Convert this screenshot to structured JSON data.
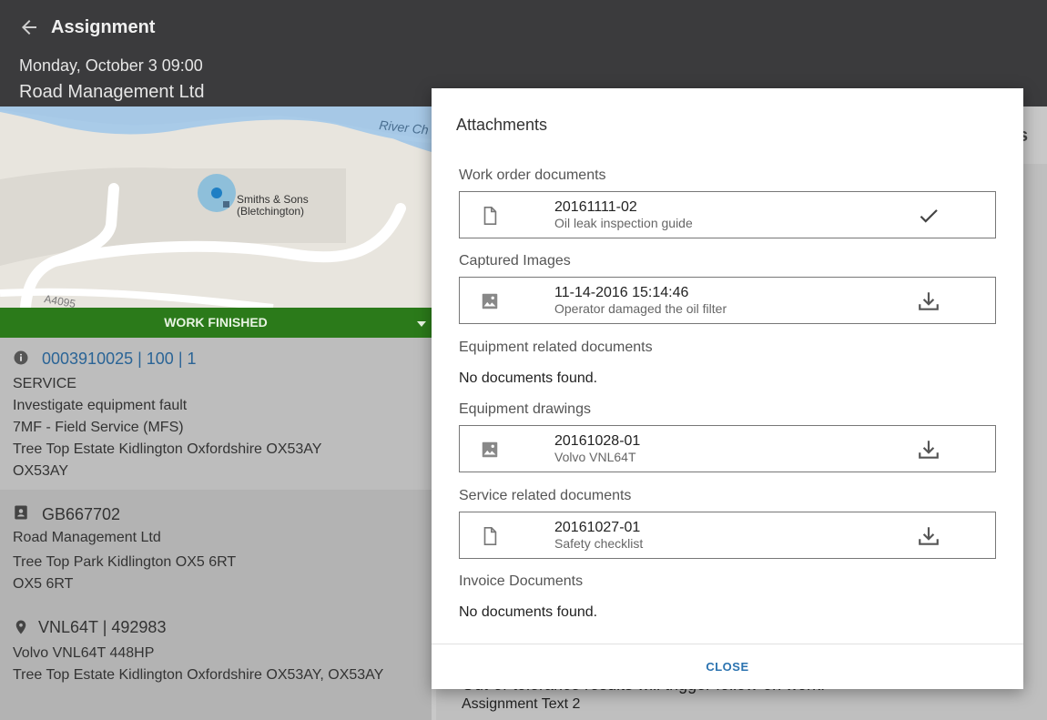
{
  "header": {
    "title": "Assignment",
    "date": "Monday, October 3 09:00",
    "company": "Road Management Ltd"
  },
  "map": {
    "river_label": "River Ch",
    "place_label_line1": "Smiths & Sons",
    "place_label_line2": "(Bletchington)",
    "road_label": "A4095"
  },
  "status": {
    "label": "WORK FINISHED",
    "color": "#2b7a1a"
  },
  "order": {
    "id": "0003910025 | 100 | 1",
    "type": "SERVICE",
    "description": "Investigate equipment fault",
    "activity": "7MF - Field Service (MFS)",
    "address": "Tree Top Estate Kidlington Oxfordshire OX53AY",
    "postcode": "OX53AY"
  },
  "customer": {
    "id": "GB667702",
    "name": "Road Management Ltd",
    "address": "Tree Top Park Kidlington OX5 6RT",
    "postcode": "OX5 6RT"
  },
  "equipment": {
    "id": "VNL64T | 492983",
    "name": "Volvo VNL64T 448HP",
    "address": "Tree Top Estate Kidlington Oxfordshire OX53AY, OX53AY"
  },
  "background": {
    "tab_fragment": "s",
    "text1": "Out-of-tolerance results will trigger follow-on work.",
    "text2": "Assignment Text 2"
  },
  "dialog": {
    "title": "Attachments",
    "sections": {
      "work_order": {
        "label": "Work order documents",
        "items": [
          {
            "name": "20161111-02",
            "description": "Oil leak inspection guide",
            "icon": "document-icon",
            "action": "check-icon"
          }
        ]
      },
      "captured_images": {
        "label": "Captured Images",
        "items": [
          {
            "name": "11-14-2016 15:14:46",
            "description": "Operator damaged the oil filter",
            "icon": "image-icon",
            "action": "download-icon"
          }
        ]
      },
      "equipment_related": {
        "label": "Equipment related documents",
        "empty_text": "No documents found."
      },
      "equipment_drawings": {
        "label": "Equipment drawings",
        "items": [
          {
            "name": "20161028-01",
            "description": "Volvo VNL64T",
            "icon": "image-icon",
            "action": "download-icon"
          }
        ]
      },
      "service_related": {
        "label": "Service related documents",
        "items": [
          {
            "name": "20161027-01",
            "description": "Safety checklist",
            "icon": "document-icon",
            "action": "download-icon"
          }
        ]
      },
      "invoice": {
        "label": "Invoice Documents",
        "empty_text": "No documents found."
      }
    },
    "close_label": "CLOSE"
  }
}
